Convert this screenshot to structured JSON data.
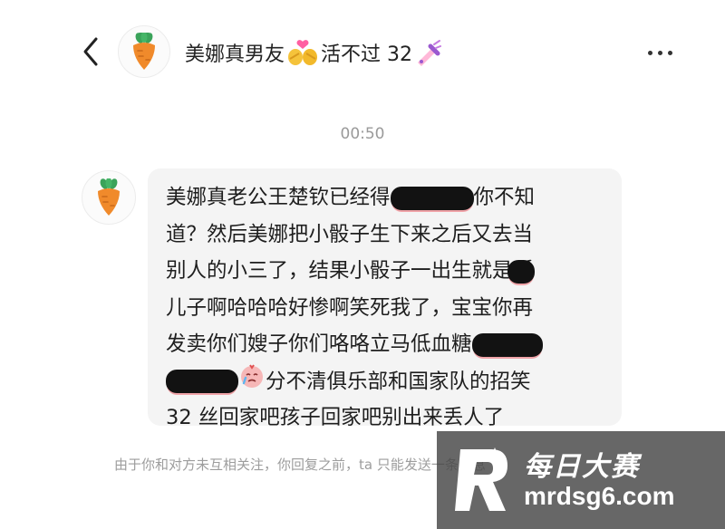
{
  "header": {
    "back_icon": "chevron-left-icon",
    "avatar_icon": "carrot-icon",
    "title_part1": "美娜真男友",
    "title_part2": "活不过 32",
    "more_icon": "more-dots-icon"
  },
  "chat": {
    "timestamp": "00:50",
    "message": {
      "avatar_icon": "carrot-icon",
      "lines": [
        [
          "美娜真老公王楚钦已经得",
          "你不知"
        ],
        [
          "道？然后美娜把小骰子生下来之后又去当"
        ],
        [
          "别人的小三了，结果小骰子一出生就是孤"
        ],
        [
          "儿子啊哈哈哈好惨啊笑死我了，宝宝你再"
        ],
        [
          "发卖你们嫂子你们咯咯立马低血糖"
        ],
        [
          "分不清俱乐部和国家队的招笑"
        ],
        [
          "32 丝回家吧孩子回家吧别出来丢人了"
        ]
      ]
    },
    "notice": "由于你和对方未互相关注，你回复之前，ta 只能发送一条消息"
  },
  "watermark": {
    "cn": "每日大赛",
    "en": "mrdsg6.com"
  },
  "colors": {
    "background": "#ffffff",
    "bubble": "#f4f4f4",
    "timestamp": "#9a9a9a",
    "carrot": "#f08a2b",
    "leaf": "#3aa35a"
  }
}
